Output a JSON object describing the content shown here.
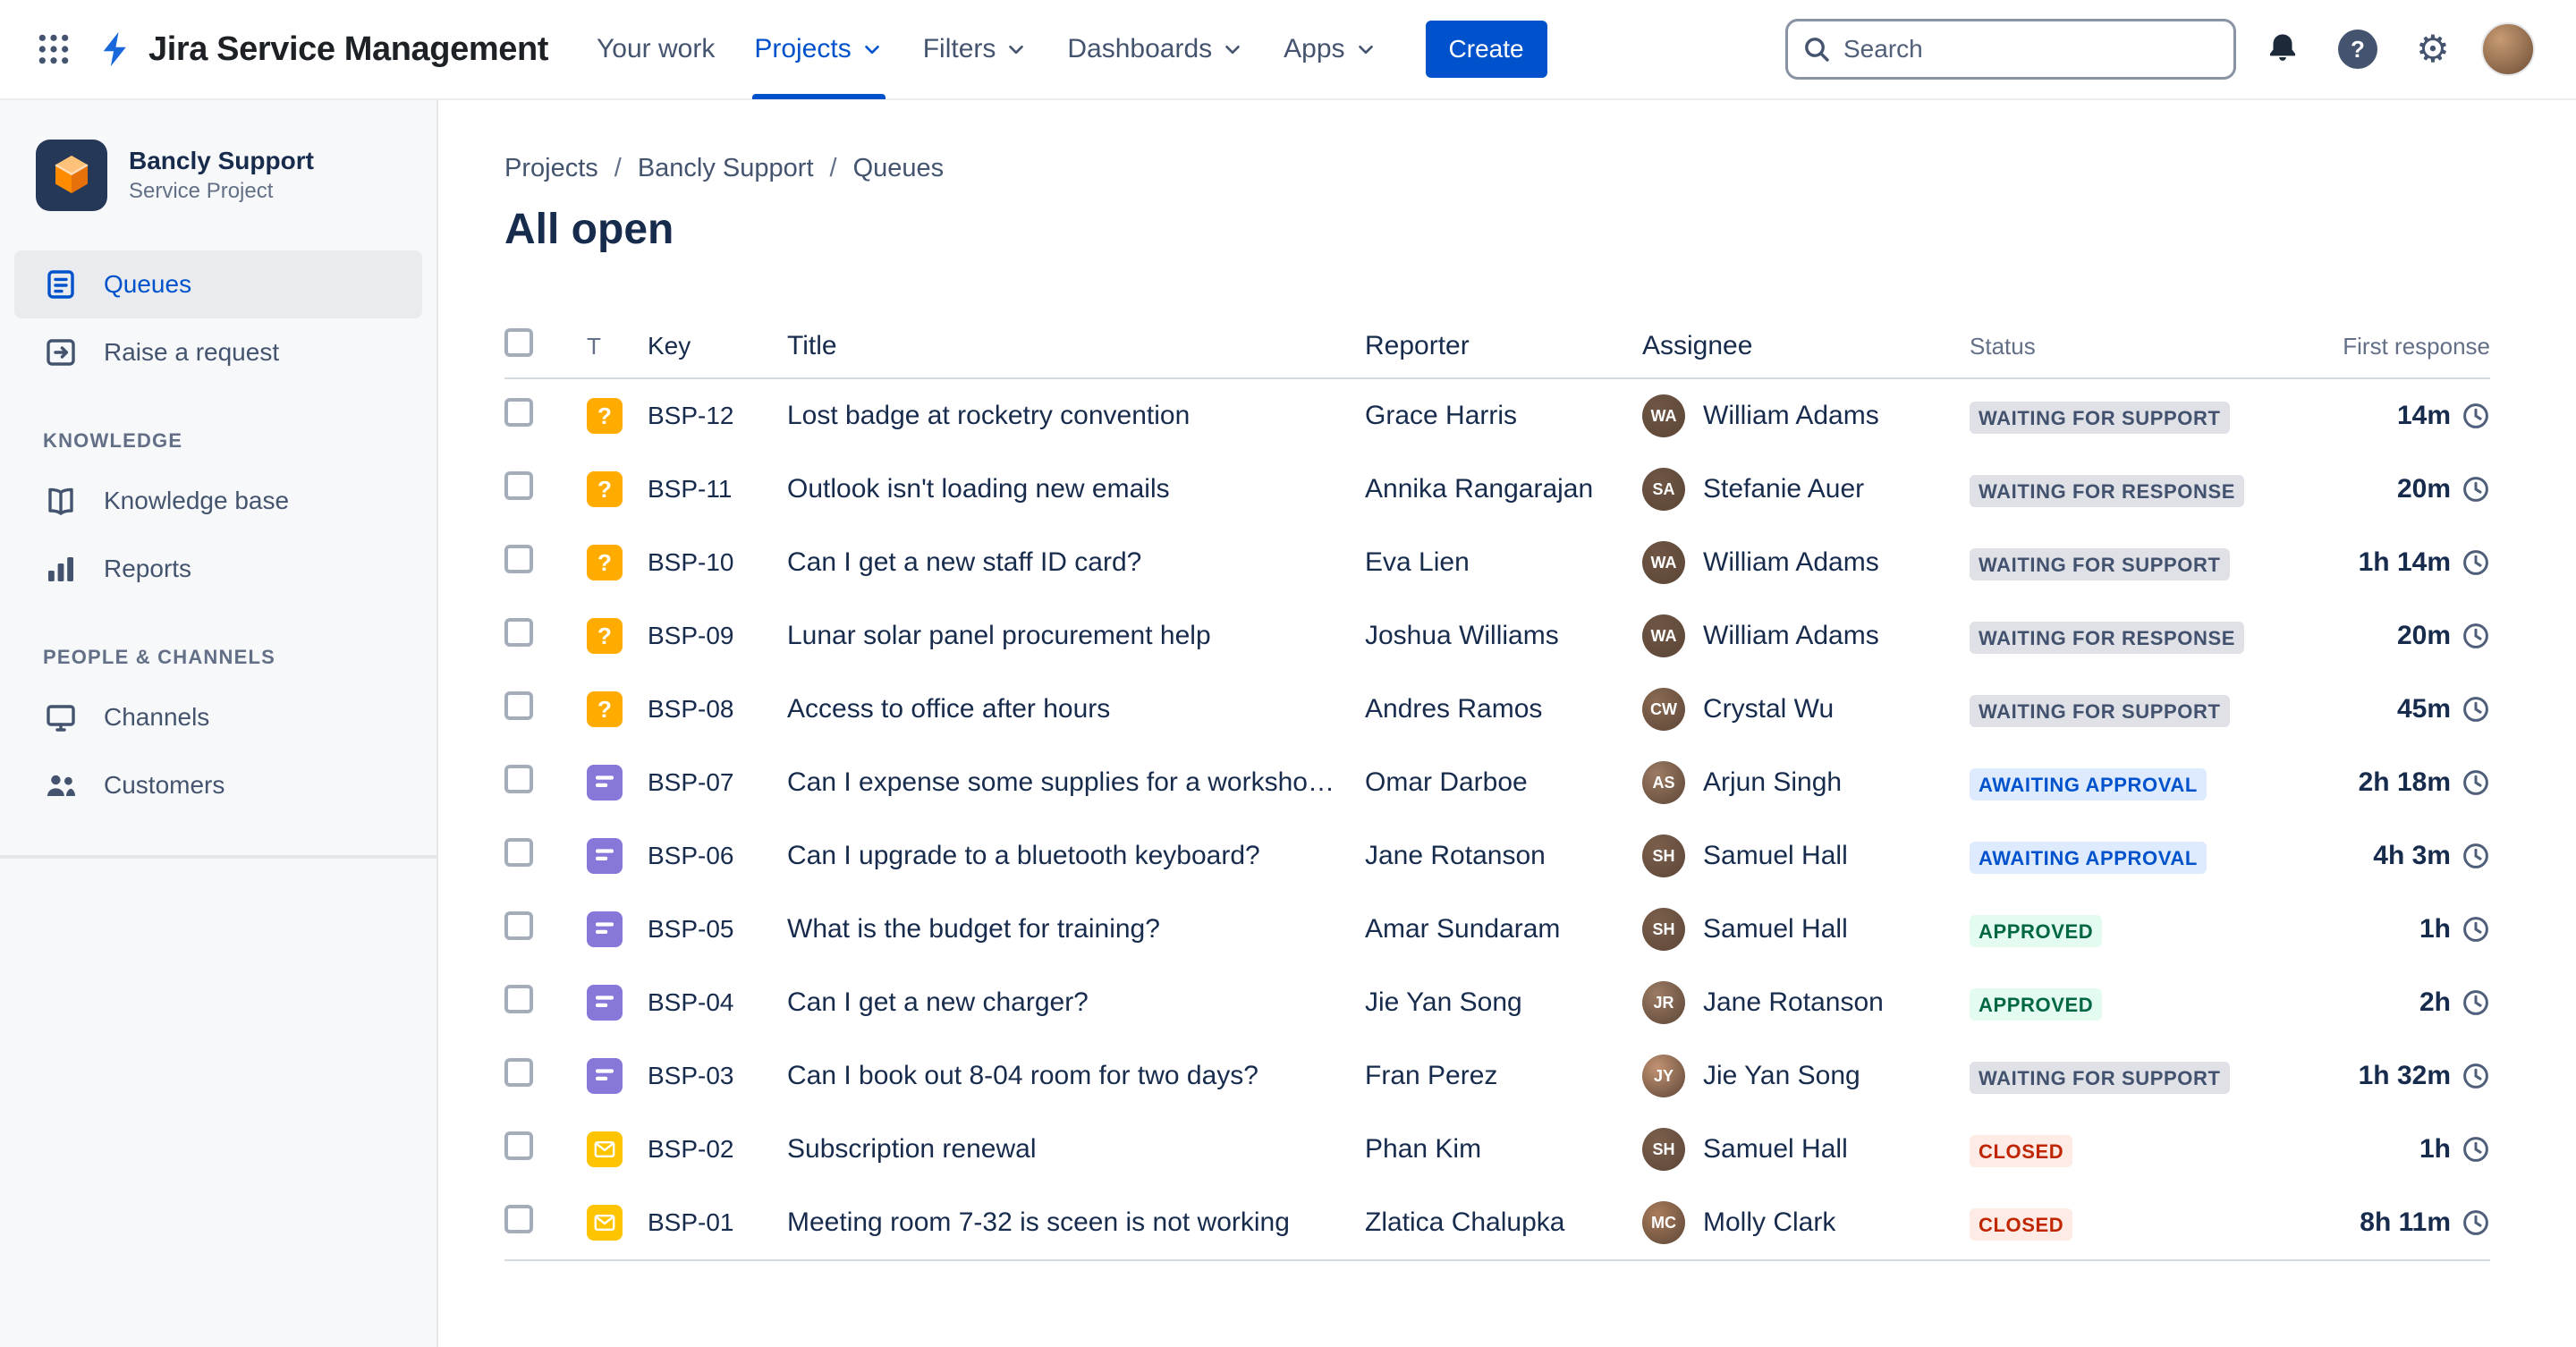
{
  "topbar": {
    "product": "Jira Service Management",
    "nav": [
      {
        "label": "Your work",
        "dropdown": false,
        "active": false
      },
      {
        "label": "Projects",
        "dropdown": true,
        "active": true
      },
      {
        "label": "Filters",
        "dropdown": true,
        "active": false
      },
      {
        "label": "Dashboards",
        "dropdown": true,
        "active": false
      },
      {
        "label": "Apps",
        "dropdown": true,
        "active": false
      }
    ],
    "create_label": "Create",
    "search_placeholder": "Search"
  },
  "sidebar": {
    "project": {
      "name": "Bancly Support",
      "type": "Service Project"
    },
    "sections": [
      {
        "label": "KNOWLEDGE"
      },
      {
        "label": "PEOPLE & CHANNELS"
      }
    ],
    "items": {
      "queues": "Queues",
      "raise_request": "Raise a request",
      "knowledge_base": "Knowledge base",
      "reports": "Reports",
      "channels": "Channels",
      "customers": "Customers"
    }
  },
  "breadcrumb": [
    "Projects",
    "Bancly Support",
    "Queues"
  ],
  "page": {
    "title": "All open"
  },
  "table": {
    "headers": [
      "T",
      "Key",
      "Title",
      "Reporter",
      "Assignee",
      "Status",
      "First response"
    ],
    "rows": [
      {
        "key": "BSP-12",
        "type": "question",
        "title": "Lost badge at rocketry convention",
        "reporter": "Grace Harris",
        "assignee": "William Adams",
        "status": "WAITING FOR SUPPORT",
        "status_color": "gray",
        "first_response": "14m"
      },
      {
        "key": "BSP-11",
        "type": "question",
        "title": "Outlook isn't loading new emails",
        "reporter": "Annika Rangarajan",
        "assignee": "Stefanie Auer",
        "status": "WAITING FOR RESPONSE",
        "status_color": "gray",
        "first_response": "20m"
      },
      {
        "key": "BSP-10",
        "type": "question",
        "title": "Can I get a new staff ID card?",
        "reporter": "Eva Lien",
        "assignee": "William Adams",
        "status": "WAITING FOR SUPPORT",
        "status_color": "gray",
        "first_response": "1h 14m"
      },
      {
        "key": "BSP-09",
        "type": "question",
        "title": "Lunar solar panel procurement help",
        "reporter": "Joshua Williams",
        "assignee": "William Adams",
        "status": "WAITING FOR RESPONSE",
        "status_color": "gray",
        "first_response": "20m"
      },
      {
        "key": "BSP-08",
        "type": "question",
        "title": "Access to office after hours",
        "reporter": "Andres Ramos",
        "assignee": "Crystal Wu",
        "status": "WAITING FOR SUPPORT",
        "status_color": "gray",
        "first_response": "45m"
      },
      {
        "key": "BSP-07",
        "type": "form",
        "title": "Can I expense some supplies for a workshop?",
        "reporter": "Omar Darboe",
        "assignee": "Arjun Singh",
        "status": "AWAITING APPROVAL",
        "status_color": "blue",
        "first_response": "2h 18m"
      },
      {
        "key": "BSP-06",
        "type": "form",
        "title": "Can I upgrade to a bluetooth keyboard?",
        "reporter": "Jane Rotanson",
        "assignee": "Samuel Hall",
        "status": "AWAITING APPROVAL",
        "status_color": "blue",
        "first_response": "4h 3m"
      },
      {
        "key": "BSP-05",
        "type": "form",
        "title": "What is the budget for training?",
        "reporter": "Amar Sundaram",
        "assignee": "Samuel Hall",
        "status": "APPROVED",
        "status_color": "green",
        "first_response": "1h"
      },
      {
        "key": "BSP-04",
        "type": "form",
        "title": "Can I get a new charger?",
        "reporter": "Jie Yan Song",
        "assignee": "Jane Rotanson",
        "status": "APPROVED",
        "status_color": "green",
        "first_response": "2h"
      },
      {
        "key": "BSP-03",
        "type": "form",
        "title": "Can I book out 8-04 room for two days?",
        "reporter": "Fran Perez",
        "assignee": "Jie Yan Song",
        "status": "WAITING FOR SUPPORT",
        "status_color": "gray",
        "first_response": "1h 32m"
      },
      {
        "key": "BSP-02",
        "type": "email",
        "title": "Subscription renewal",
        "reporter": "Phan Kim",
        "assignee": "Samuel Hall",
        "status": "CLOSED",
        "status_color": "red",
        "first_response": "1h"
      },
      {
        "key": "BSP-01",
        "type": "email",
        "title": "Meeting room 7-32 is sceen is not working",
        "reporter": "Zlatica Chalupka",
        "assignee": "Molly Clark",
        "status": "CLOSED",
        "status_color": "red",
        "first_response": "8h 11m"
      }
    ]
  },
  "colors": {
    "brand_blue": "#0052CC",
    "status": {
      "gray": {
        "bg": "#DFE1E6",
        "fg": "#42526E"
      },
      "blue": {
        "bg": "#DEEBFF",
        "fg": "#0052CC"
      },
      "green": {
        "bg": "#E3FCEF",
        "fg": "#006644"
      },
      "red": {
        "bg": "#FFEBE6",
        "fg": "#BF2600"
      }
    },
    "request_type": {
      "question": "#FFAB00",
      "form": "#8777D9",
      "email": "#FFC400"
    },
    "avatar_palette": [
      "#A97C5B",
      "#8A6A52",
      "#B98A66",
      "#7B5F4C",
      "#C29272",
      "#6E5544",
      "#9C7B63"
    ]
  }
}
